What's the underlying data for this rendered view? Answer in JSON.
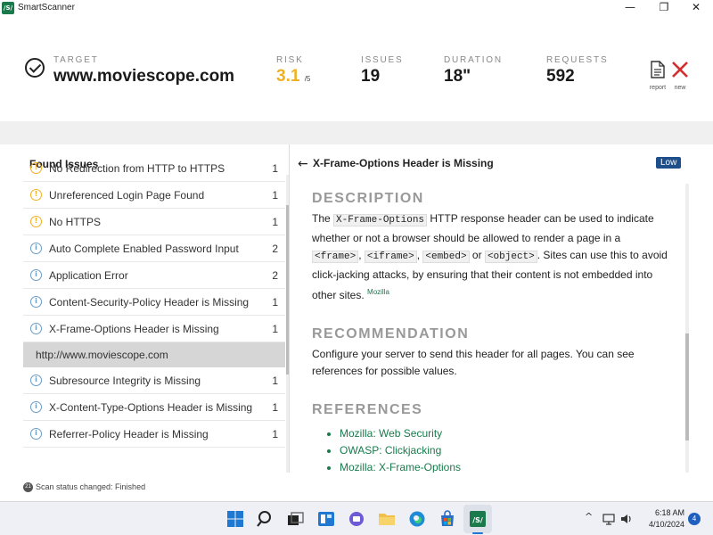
{
  "window": {
    "logo": "/S/",
    "title": "SmartScanner",
    "minimize": "—",
    "maximize": "❐",
    "close": "✕"
  },
  "header": {
    "target_label": "TARGET",
    "target_value": "www.moviescope.com",
    "risk_label": "RISK",
    "risk_value": "3.1",
    "risk_unit": "/5",
    "issues_label": "ISSUES",
    "issues_value": "19",
    "duration_label": "DURATION",
    "duration_value": "18\"",
    "requests_label": "REQUESTS",
    "requests_value": "592",
    "report_label": "report",
    "new_label": "new",
    "accent_color": "#f0b020",
    "new_icon_color": "#d32f2f"
  },
  "left_panel": {
    "title": "Found Issues",
    "rows_before_group": [
      {
        "icon": "warning-icon",
        "severity": "warn",
        "name": "No Redirection from HTTP to HTTPS",
        "count": "1"
      },
      {
        "icon": "warning-icon",
        "severity": "warn",
        "name": "Unreferenced Login Page Found",
        "count": "1"
      },
      {
        "icon": "warning-icon",
        "severity": "warn",
        "name": "No HTTPS",
        "count": "1"
      },
      {
        "icon": "info-icon",
        "severity": "info",
        "name": "Auto Complete Enabled Password Input",
        "count": "2"
      },
      {
        "icon": "info-icon",
        "severity": "info",
        "name": "Application Error",
        "count": "2"
      },
      {
        "icon": "info-icon",
        "severity": "info",
        "name": "Content-Security-Policy Header is Missing",
        "count": "1"
      },
      {
        "icon": "info-icon",
        "severity": "info",
        "name": "X-Frame-Options Header is Missing",
        "count": "1"
      }
    ],
    "group_label": "http://www.moviescope.com",
    "rows_after_group": [
      {
        "icon": "info-icon",
        "severity": "info",
        "name": "Subresource Integrity is Missing",
        "count": "1"
      },
      {
        "icon": "info-icon",
        "severity": "info",
        "name": "X-Content-Type-Options Header is Missing",
        "count": "1"
      },
      {
        "icon": "info-icon",
        "severity": "info",
        "name": "Referrer-Policy Header is Missing",
        "count": "1"
      }
    ]
  },
  "detail": {
    "back_icon": "←",
    "title": "X-Frame-Options Header is Missing",
    "severity_badge": "Low",
    "description_heading": "DESCRIPTION",
    "desc_part1": "The ",
    "desc_code1": "X-Frame-Options",
    "desc_part2": " HTTP response header can be used to indicate whether or not a browser should be allowed to render a page in a ",
    "desc_code2": "<frame>",
    "desc_sep1": ", ",
    "desc_code3": "<iframe>",
    "desc_sep2": ", ",
    "desc_code4": "<embed>",
    "desc_sep3": " or ",
    "desc_code5": "<object>",
    "desc_part3": ". Sites can use this to avoid click-jacking attacks, by ensuring that their content is not embedded into other sites. ",
    "desc_source": "Mozilla",
    "recommendation_heading": "RECOMMENDATION",
    "recommendation_text": "Configure your server to send this header for all pages. You can see references for possible values.",
    "references_heading": "REFERENCES",
    "references": [
      "Mozilla: Web Security",
      "OWASP: Clickjacking",
      "Mozilla: X-Frame-Options"
    ]
  },
  "status": {
    "icon_text": "21",
    "text": "Scan status changed: Finished"
  },
  "taskbar": {
    "tray_chevron": "^",
    "time": "6:18 AM",
    "date": "4/10/2024",
    "notification_count": "4"
  }
}
